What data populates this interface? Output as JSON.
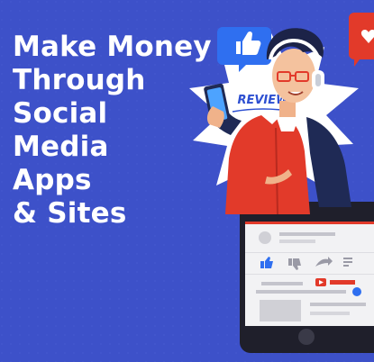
{
  "headline": [
    "Make Money",
    "Through",
    "Social",
    "Media",
    "Apps",
    "& Sites"
  ],
  "badge": "REVIEW",
  "colors": {
    "background": "#3d51c9",
    "text": "#ffffff",
    "like_badge": "#2f6ff0",
    "red": "#e23a2a",
    "phone_frame": "#1f1f2b",
    "phone_screen": "#f2f2f4"
  },
  "icons": [
    "thumbs-up-icon",
    "heart-icon",
    "play-icon",
    "thumbs-down-icon",
    "share-icon",
    "settings-icon",
    "headphones-icon",
    "chevron-down-icon",
    "smartphone-icon"
  ]
}
